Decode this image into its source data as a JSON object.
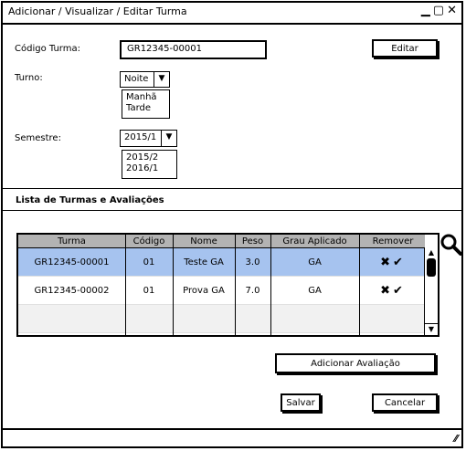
{
  "window": {
    "title": "Adicionar / Visualizar / Editar Turma"
  },
  "form": {
    "codigo_label": "Código Turma:",
    "codigo_value": "GR12345-00001",
    "editar_label": "Editar",
    "turno_label": "Turno:",
    "turno_value": "Noite",
    "turno_options": [
      "Manhã",
      "Tarde"
    ],
    "semestre_label": "Semestre:",
    "semestre_value": "2015/1",
    "semestre_options": [
      "2015/2",
      "2016/1"
    ]
  },
  "section_title": "Lista de Turmas e Avaliações",
  "table": {
    "columns": [
      "Turma",
      "Código",
      "Nome",
      "Peso",
      "Grau Aplicado",
      "Remover"
    ],
    "rows": [
      {
        "turma": "GR12345-00001",
        "codigo": "01",
        "nome": "Teste GA",
        "peso": "3.0",
        "grau": "GA",
        "remover": "✖✔"
      },
      {
        "turma": "GR12345-00002",
        "codigo": "01",
        "nome": "Prova GA",
        "peso": "7.0",
        "grau": "GA",
        "remover": "✖✔"
      }
    ]
  },
  "buttons": {
    "adicionar": "Adicionar Avaliação",
    "salvar": "Salvar",
    "cancelar": "Cancelar"
  },
  "icons": {
    "search": "search-icon",
    "minimize": "minimize-icon",
    "maximize": "maximize-icon",
    "close": "close-icon",
    "resize": "resize-grip-icon"
  },
  "colors": {
    "selected_row": "#a6c3ef",
    "header": "#b3b3b3"
  }
}
